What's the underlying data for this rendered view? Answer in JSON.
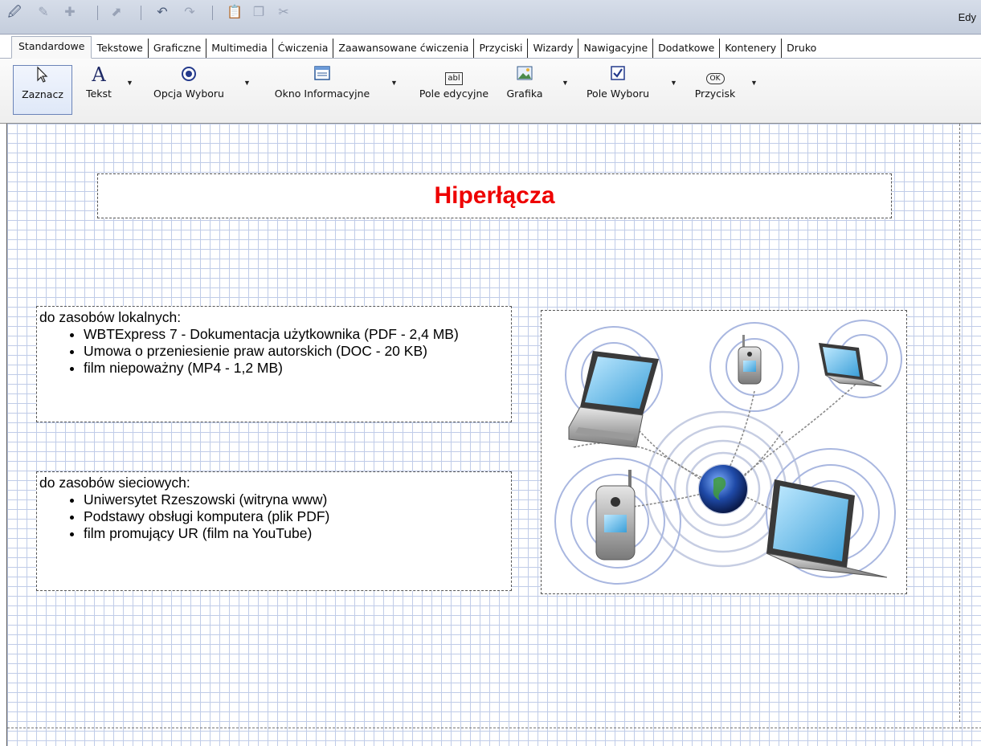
{
  "toolbar": {
    "icons": [
      "edit-mode-icon",
      "edit-icon",
      "add-icon",
      "export-icon",
      "undo-icon",
      "redo-icon",
      "paste-icon",
      "copy-icon",
      "cut-icon"
    ],
    "right_label": "Edy"
  },
  "tabs": [
    {
      "label": "Standardowe",
      "active": true
    },
    {
      "label": "Tekstowe"
    },
    {
      "label": "Graficzne"
    },
    {
      "label": "Multimedia"
    },
    {
      "label": "Ćwiczenia"
    },
    {
      "label": "Zaawansowane ćwiczenia"
    },
    {
      "label": "Przyciski"
    },
    {
      "label": "Wizardy"
    },
    {
      "label": "Nawigacyjne"
    },
    {
      "label": "Dodatkowe"
    },
    {
      "label": "Kontenery"
    },
    {
      "label": "Druko"
    }
  ],
  "ribbon": {
    "tools": [
      {
        "label": "Zaznacz",
        "icon": "pointer-icon",
        "selected": true
      },
      {
        "label": "Tekst",
        "icon": "text-icon"
      },
      {
        "label": "Opcja Wyboru",
        "icon": "radio-icon"
      },
      {
        "label": "Okno Informacyjne",
        "icon": "info-window-icon"
      },
      {
        "label": "Pole edycyjne",
        "icon": "edit-field-icon"
      },
      {
        "label": "Grafika",
        "icon": "image-icon"
      },
      {
        "label": "Pole Wyboru",
        "icon": "checkbox-icon"
      },
      {
        "label": "Przycisk",
        "icon": "button-icon"
      }
    ],
    "edit_field_glyph": "abl",
    "button_glyph": "OK"
  },
  "slide": {
    "title": "Hiperłącza",
    "title_color": "#ee0000",
    "local": {
      "heading": "do zasobów lokalnych:",
      "items": [
        "WBTExpress 7 - Dokumentacja użytkownika (PDF - 2,4 MB)",
        "Umowa o przeniesienie praw autorskich (DOC - 20 KB)",
        "film niepoważny (MP4 - 1,2 MB)"
      ]
    },
    "network": {
      "heading": "do zasobów sieciowych:",
      "items": [
        "Uniwersytet Rzeszowski (witryna www)",
        "Podstawy obsługi komputera (plik PDF)",
        "film promujący UR (film na YouTube)"
      ]
    },
    "image": {
      "icon": "network-illustration-icon"
    }
  }
}
